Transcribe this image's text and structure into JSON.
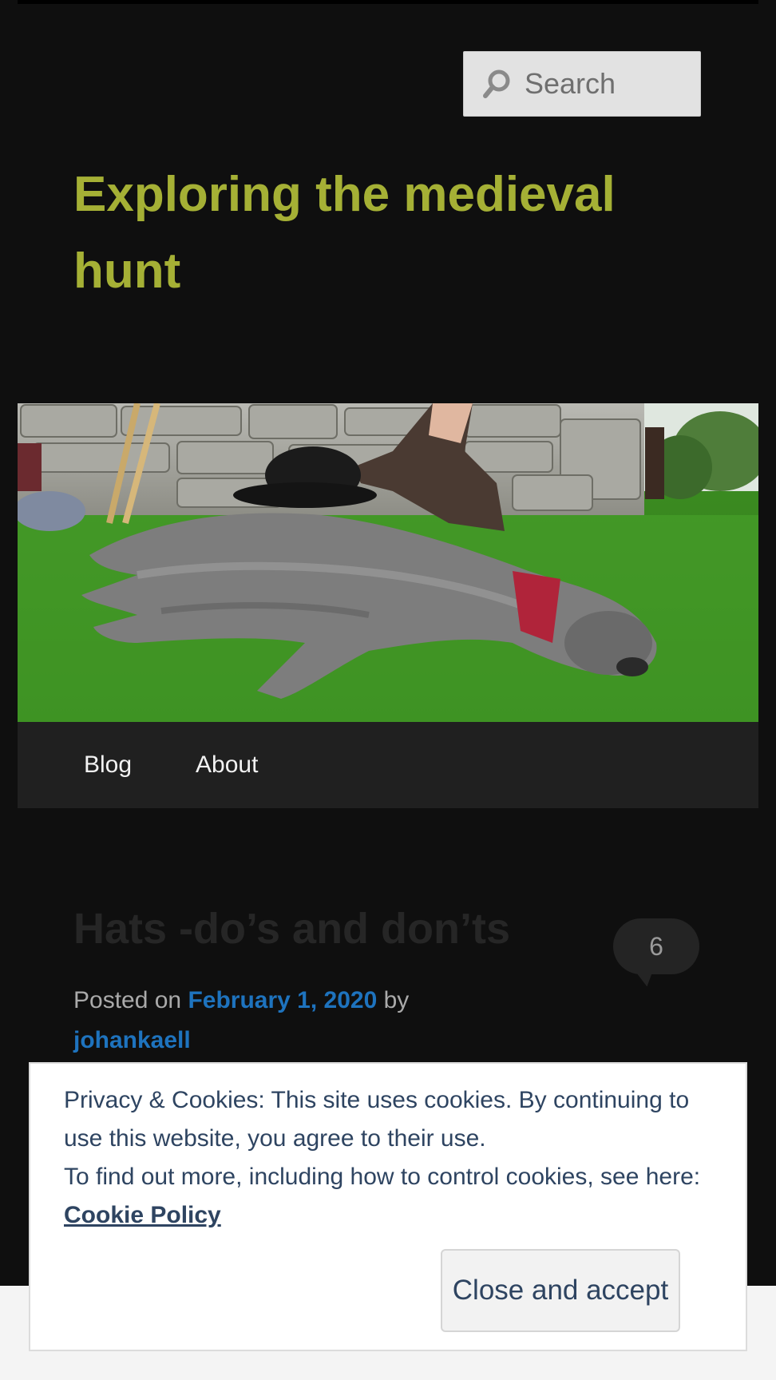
{
  "header": {
    "search_placeholder": "Search",
    "site_title": "Exploring the medieval hunt"
  },
  "nav": {
    "items": [
      {
        "label": "Blog"
      },
      {
        "label": "About"
      }
    ]
  },
  "post": {
    "title": "Hats -do’s and don’ts",
    "comment_count": "6",
    "posted_on_prefix": "Posted on",
    "date": "February 1, 2020",
    "by": "by",
    "author": "johankaell"
  },
  "cookie_notice": {
    "line1": "Privacy & Cookies: This site uses cookies. By continuing to use this website, you agree to their use.",
    "line2_prefix": "To find out more, including how to control cookies, see here:",
    "policy_link": "Cookie Policy",
    "accept_label": "Close and accept"
  },
  "colors": {
    "background": "#0f0f0f",
    "site_title": "#a5b035",
    "link": "#1e73be",
    "cookie_text": "#2e4461"
  },
  "icons": {
    "search": "search-icon",
    "comment": "comment-bubble-icon"
  }
}
